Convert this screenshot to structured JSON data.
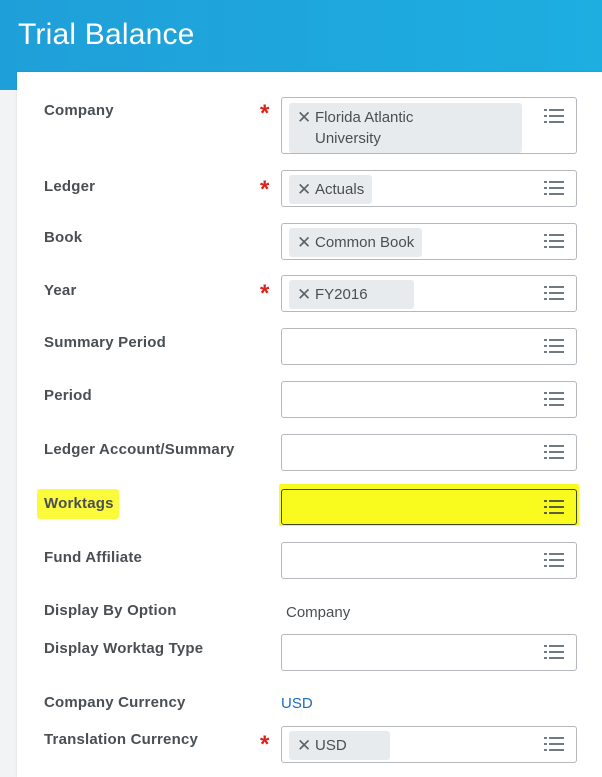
{
  "page": {
    "title": "Trial Balance"
  },
  "form": {
    "company": {
      "label": "Company",
      "required": true,
      "value_line1": "Florida Atlantic",
      "value_line2": "University"
    },
    "ledger": {
      "label": "Ledger",
      "required": true,
      "value": "Actuals"
    },
    "book": {
      "label": "Book",
      "required": false,
      "value": "Common Book"
    },
    "year": {
      "label": "Year",
      "required": true,
      "value": "FY2016"
    },
    "summary_period": {
      "label": "Summary Period",
      "required": false,
      "value": ""
    },
    "period": {
      "label": "Period",
      "required": false,
      "value": ""
    },
    "ledger_account_summary": {
      "label": "Ledger Account/Summary",
      "required": false,
      "value": ""
    },
    "worktags": {
      "label": "Worktags",
      "required": false,
      "value": "",
      "highlight_color": "#f9fb1e"
    },
    "fund_affiliate": {
      "label": "Fund Affiliate",
      "required": false,
      "value": ""
    },
    "display_by_option": {
      "label": "Display By Option",
      "value": "Company"
    },
    "display_worktag_type": {
      "label": "Display Worktag Type",
      "required": false,
      "value": ""
    },
    "company_currency": {
      "label": "Company Currency",
      "value": "USD"
    },
    "translation_currency": {
      "label": "Translation Currency",
      "required": true,
      "value": "USD"
    }
  },
  "symbols": {
    "required": "*",
    "remove": "✕"
  },
  "icons": {
    "prompt": "list-prompt-icon",
    "remove": "close-icon"
  },
  "colors": {
    "header": "#1fa7dd",
    "required": "#d9231c",
    "link": "#1c6dbd",
    "highlight": "#f9fb1e"
  }
}
